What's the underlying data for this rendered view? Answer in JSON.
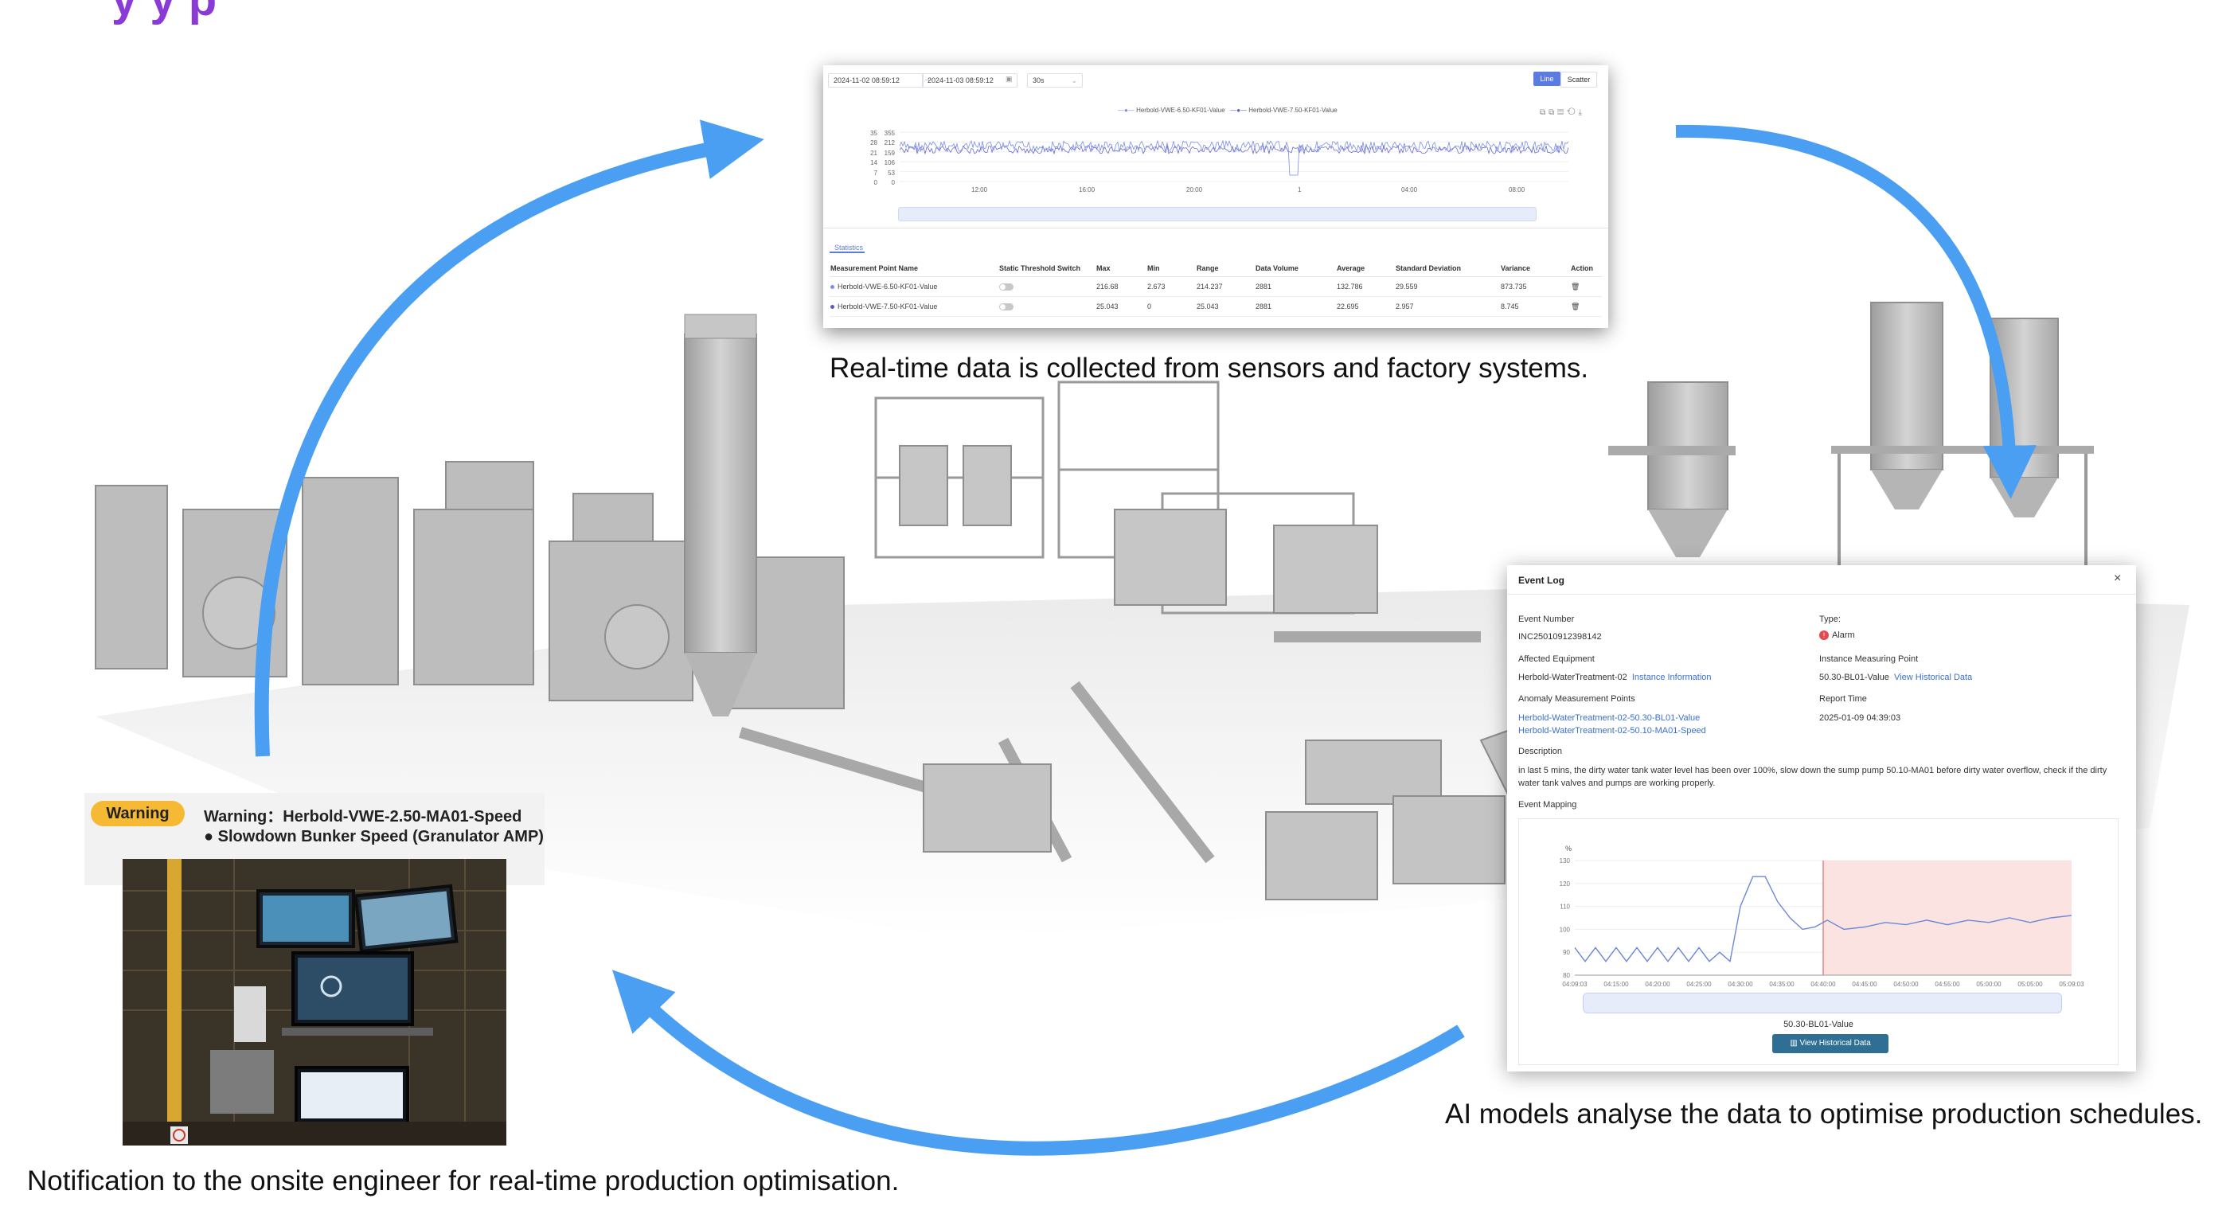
{
  "header_fragment": "y                          y p",
  "chart_panel": {
    "start_date": "2024-11-02 08:59:12",
    "end_date": "2024-11-03 08:59:12",
    "interval": "30s",
    "toggle_line": "Line",
    "toggle_scatter": "Scatter",
    "legend": [
      "Herbold-VWE-6.50-KF01-Value",
      "Herbold-VWE-7.50-KF01-Value"
    ],
    "colors": {
      "series1": "#7b8ee8",
      "series2": "#5a58c8",
      "accent": "#5b7be0",
      "alert": "#e5484d"
    },
    "y_ticks_left": [
      "35",
      "28",
      "21",
      "14",
      "7",
      "0"
    ],
    "y_ticks_right": [
      "355",
      "212",
      "159",
      "106",
      "53",
      "0"
    ],
    "x_ticks": [
      "12:00",
      "16:00",
      "20:00",
      "1",
      "04:00",
      "08:00"
    ],
    "stats_tab": "Statistics",
    "columns": [
      "Measurement Point Name",
      "Static Threshold Switch",
      "Max",
      "Min",
      "Range",
      "Data Volume",
      "Average",
      "Standard Deviation",
      "Variance",
      "Action"
    ],
    "rows": [
      {
        "name": "Herbold-VWE-6.50-KF01-Value",
        "max": "216.68",
        "min": "2.673",
        "range": "214.237",
        "volume": "2881",
        "avg": "132.786",
        "std": "29.559",
        "var": "873.735"
      },
      {
        "name": "Herbold-VWE-7.50-KF01-Value",
        "max": "25.043",
        "min": "0",
        "range": "25.043",
        "volume": "2881",
        "avg": "22.695",
        "std": "2.957",
        "var": "8.745"
      }
    ]
  },
  "captions": {
    "collect": "Real-time data is collected from sensors and factory systems.",
    "analyse": "AI models analyse the data to optimise production schedules.",
    "notify": "Notification to the onsite engineer for real-time production optimisation."
  },
  "event_log": {
    "title": "Event Log",
    "event_number_label": "Event Number",
    "event_number": "INC25010912398142",
    "type_label": "Type:",
    "type_value": "Alarm",
    "affected_label": "Affected Equipment",
    "affected_value": "Herbold-WaterTreatment-02",
    "instance_info": "Instance Information",
    "imp_label": "Instance Measuring Point",
    "imp_value": "50.30-BL01-Value",
    "view_hist_link": "View Historical Data",
    "anomaly_label": "Anomaly Measurement Points",
    "anomaly_points": [
      "Herbold-WaterTreatment-02-50.30-BL01-Value",
      "Herbold-WaterTreatment-02-50.10-MA01-Speed"
    ],
    "report_label": "Report Time",
    "report_time": "2025-01-09 04:39:03",
    "desc_label": "Description",
    "description": "in last 5 mins, the dirty water tank water level has been over 100%, slow down the sump pump 50.10-MA01 before dirty water overflow, check if the dirty water tank valves and pumps are working properly.",
    "mapping_label": "Event Mapping",
    "chart_unit": "%",
    "chart_series": "50.30-BL01-Value",
    "view_button": "View Historical Data"
  },
  "chart_data": {
    "type": "line",
    "title": "",
    "xlabel": "",
    "ylabel": "%",
    "ylim": [
      80,
      130
    ],
    "yticks": [
      80,
      90,
      100,
      110,
      120,
      130
    ],
    "categories": [
      "04:09:03",
      "04:15:00",
      "04:20:00",
      "04:25:00",
      "04:30:00",
      "04:35:00",
      "04:40:00",
      "04:45:00",
      "04:50:00",
      "04:55:00",
      "05:00:00",
      "05:05:00",
      "05:09:03"
    ],
    "series": [
      {
        "name": "50.30-BL01-Value",
        "x_index": [
          0,
          0.25,
          0.5,
          0.75,
          1,
          1.25,
          1.5,
          1.75,
          2,
          2.25,
          2.5,
          2.75,
          3,
          3.25,
          3.5,
          3.75,
          4,
          4.3,
          4.6,
          4.9,
          5.2,
          5.5,
          5.8,
          6.1,
          6.5,
          7,
          7.5,
          8,
          8.5,
          9,
          9.5,
          10,
          10.5,
          11,
          11.5,
          12
        ],
        "values": [
          92,
          86,
          92,
          86,
          92,
          86,
          92,
          86,
          92,
          86,
          92,
          86,
          92,
          86,
          90,
          86,
          110,
          123,
          123,
          112,
          105,
          100,
          101,
          104,
          100,
          101,
          103,
          102,
          104,
          102,
          104,
          103,
          105,
          103,
          105,
          106
        ]
      }
    ],
    "highlight_range": [
      "04:40:00",
      "05:09:03"
    ]
  },
  "warning": {
    "badge": "Warning",
    "line1": "Warning：Herbold-VWE-2.50-MA01-Speed",
    "line2": "Slowdown Bunker Speed (Granulator AMP)"
  }
}
